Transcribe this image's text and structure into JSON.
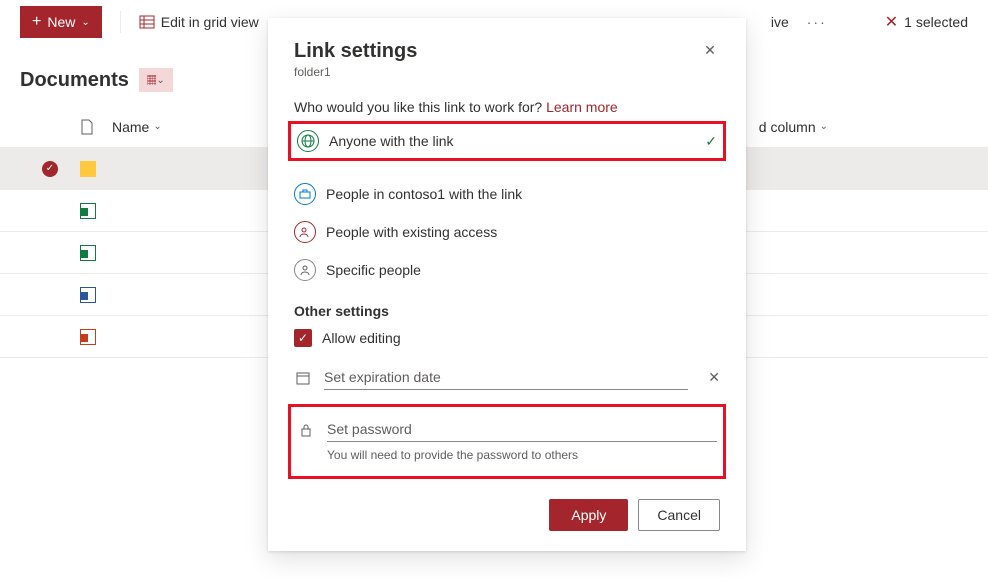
{
  "commandbar": {
    "new_label": "New",
    "edit_grid_label": "Edit in grid view",
    "drive_trunc": "ive",
    "selected_count": "1 selected"
  },
  "library": {
    "heading": "Documents"
  },
  "columns": {
    "name": "Name",
    "add_column": "d column"
  },
  "dialog": {
    "title": "Link settings",
    "item_name": "folder1",
    "who_question": "Who would you like this link to work for?",
    "learn_more": "Learn more",
    "scopes": {
      "anyone": "Anyone with the link",
      "org": "People in contoso1 with the link",
      "existing": "People with existing access",
      "specific": "Specific people"
    },
    "other_heading": "Other settings",
    "allow_editing": "Allow editing",
    "expiration_placeholder": "Set expiration date",
    "password_placeholder": "Set password",
    "password_hint": "You will need to provide the password to others",
    "apply": "Apply",
    "cancel": "Cancel"
  }
}
